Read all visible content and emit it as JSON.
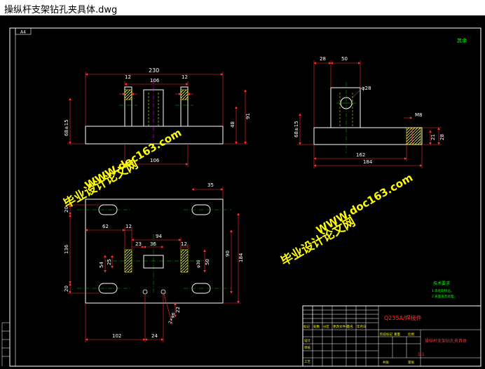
{
  "window": {
    "title": "操纵杆支架钻孔夹具体.dwg"
  },
  "sheet": {
    "size_label": "A4",
    "corner_note": "其余"
  },
  "colors": {
    "background": "#000000",
    "outline": "#ffffff",
    "dimension": "#ff3030",
    "centerline": "#00c000",
    "hidden_line": "#ffff00",
    "frame": "#ffffff",
    "hatch": "#ffff00",
    "watermark": "#ffff00",
    "title_block_text": "#ff3030",
    "table_text": "#ffff00",
    "notes": "#00ff00"
  },
  "front_view": {
    "dims": {
      "overall_width": "230",
      "inner_width": "106",
      "left_rib": "12",
      "right_rib": "12",
      "left_height": "68±15",
      "right_height_a": "48",
      "right_height_b": "91",
      "bottom_width": "106"
    }
  },
  "side_view": {
    "dims": {
      "top_left": "28",
      "top_mid": "50",
      "hole_dia": "φ28",
      "left_height": "68±15",
      "detail_width": "M8",
      "detail_h1": "21",
      "detail_h2": "28",
      "bottom_a": "162",
      "bottom_b": "184"
    }
  },
  "top_view": {
    "dims": {
      "slot_top": "35",
      "left_a": "62",
      "left_b": "12",
      "mid_a": "23",
      "mid_b": "36",
      "mid_c": "94",
      "mid_d": "12",
      "left_v1": "20",
      "left_v2": "136",
      "left_v3": "20",
      "inner_v1": "54",
      "inner_v2": "25",
      "right_v1": "50",
      "right_v2": "90",
      "right_v3": "184",
      "right_v4": "φ30",
      "bottom_a": "102",
      "bottom_b": "24",
      "bottom_c": "22",
      "bottom_hole": "2×φ6"
    }
  },
  "notes": {
    "title": "技术要求",
    "line1": "1.去毛刺锐边。",
    "line2": "2.表面发黑处理。"
  },
  "title_block": {
    "material": "Q235A/焊接件",
    "drawing_name": "操纵杆支架钻孔夹具体",
    "scale": "1:1",
    "header_cells": [
      "标记",
      "处数",
      "分区",
      "更改文件号",
      "签名",
      "年月日"
    ],
    "rows": [
      "设计",
      "审核",
      "工艺"
    ],
    "right_cells": [
      "阶段标记",
      "重量",
      "比例"
    ],
    "bottom_cells": [
      "共张",
      "第张"
    ]
  },
  "watermarks": {
    "line1": "毕业设计论文网",
    "line2": "WWW.doc163.com"
  }
}
